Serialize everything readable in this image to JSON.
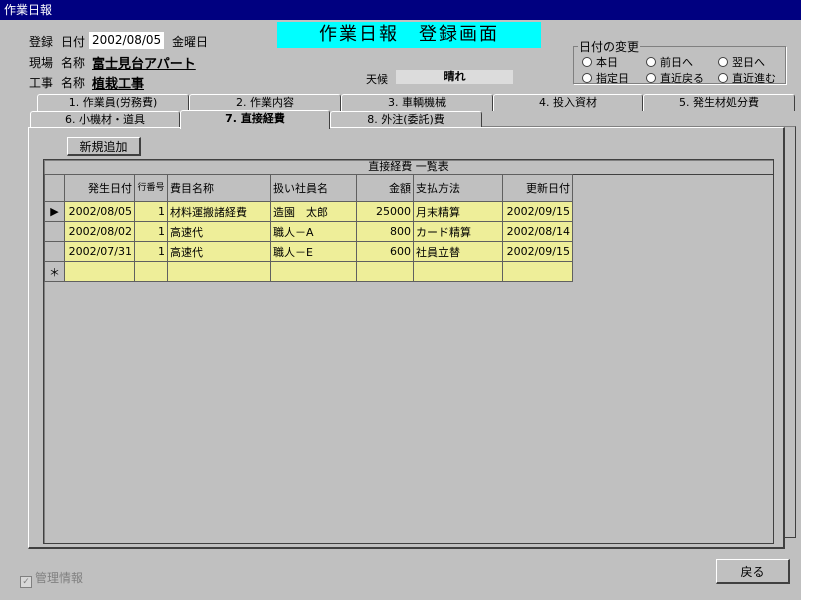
{
  "window": {
    "title": "作業日報"
  },
  "header": {
    "reg_label": "登録",
    "date_label": "日付",
    "date_value": "2002/08/05",
    "weekday": "金曜日",
    "site_label": "現場",
    "site_name_label": "名称",
    "site_name": "富士見台アパート",
    "work_label": "工事",
    "work_name_label": "名称",
    "work_name": "植栽工事",
    "weather_label": "天候",
    "weather_value": "晴れ",
    "banner": "作業日報　登録画面"
  },
  "date_change": {
    "legend": "日付の変更",
    "options": [
      "本日",
      "前日へ",
      "翌日へ",
      "指定日",
      "直近戻る",
      "直近進む"
    ]
  },
  "tabs": {
    "row1": [
      "1. 作業員(労務費)",
      "2. 作業内容",
      "3. 車輌機械",
      "4. 投入資材",
      "5. 発生材処分費"
    ],
    "row2": [
      "6. 小機材・道具",
      "7. 直接経費",
      "8. 外注(委託)費"
    ],
    "active": "7. 直接経費"
  },
  "new_button": "新規追加",
  "list": {
    "title": "直接経費  一覧表",
    "headers": [
      "発生日付",
      "行番号",
      "費目名称",
      "扱い社員名",
      "金額",
      "支払方法",
      "更新日付"
    ],
    "rows": [
      [
        "2002/08/05",
        "1",
        "材料運搬諸経費",
        "造園　太郎",
        "25000",
        "月末精算",
        "2002/09/15"
      ],
      [
        "2002/08/02",
        "1",
        "高速代",
        "職人－A",
        "800",
        "カード精算",
        "2002/08/14"
      ],
      [
        "2002/07/31",
        "1",
        "高速代",
        "職人－E",
        "600",
        "社員立替",
        "2002/09/15"
      ]
    ],
    "current_row_marker": "▶",
    "new_row_marker": "＊"
  },
  "footer": {
    "admin_checkbox": "管理情報",
    "back_button": "戻る"
  }
}
